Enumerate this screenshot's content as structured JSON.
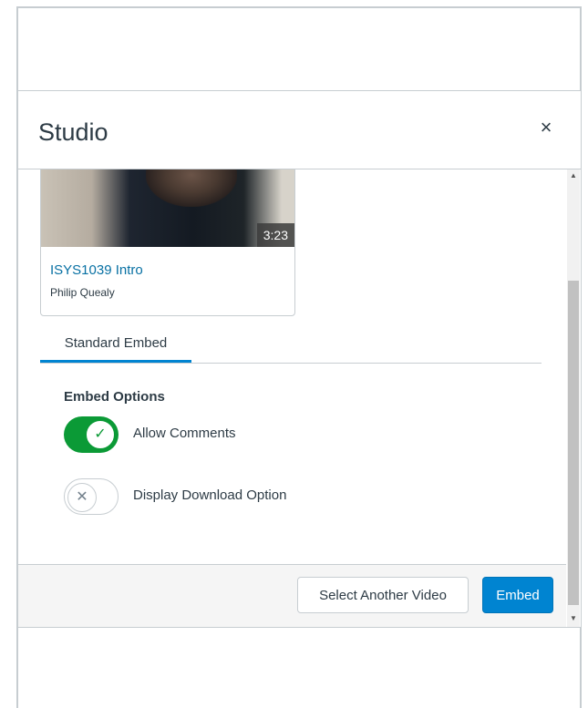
{
  "dialog": {
    "title": "Studio",
    "close_label": "×"
  },
  "video": {
    "title": "ISYS1039 Intro",
    "author": "Philip Quealy",
    "duration": "3:23"
  },
  "tabs": [
    {
      "label": "Standard Embed",
      "active": true
    }
  ],
  "embed_options": {
    "heading": "Embed Options",
    "allow_comments": {
      "label": "Allow Comments",
      "enabled": true,
      "knob_glyph": "✓"
    },
    "display_download": {
      "label": "Display Download Option",
      "enabled": false,
      "knob_glyph": "✕"
    }
  },
  "footer": {
    "select_another_label": "Select Another Video",
    "embed_label": "Embed"
  },
  "colors": {
    "primary": "#0084d1",
    "toggle_on": "#0b9a36",
    "link": "#0770a3"
  }
}
